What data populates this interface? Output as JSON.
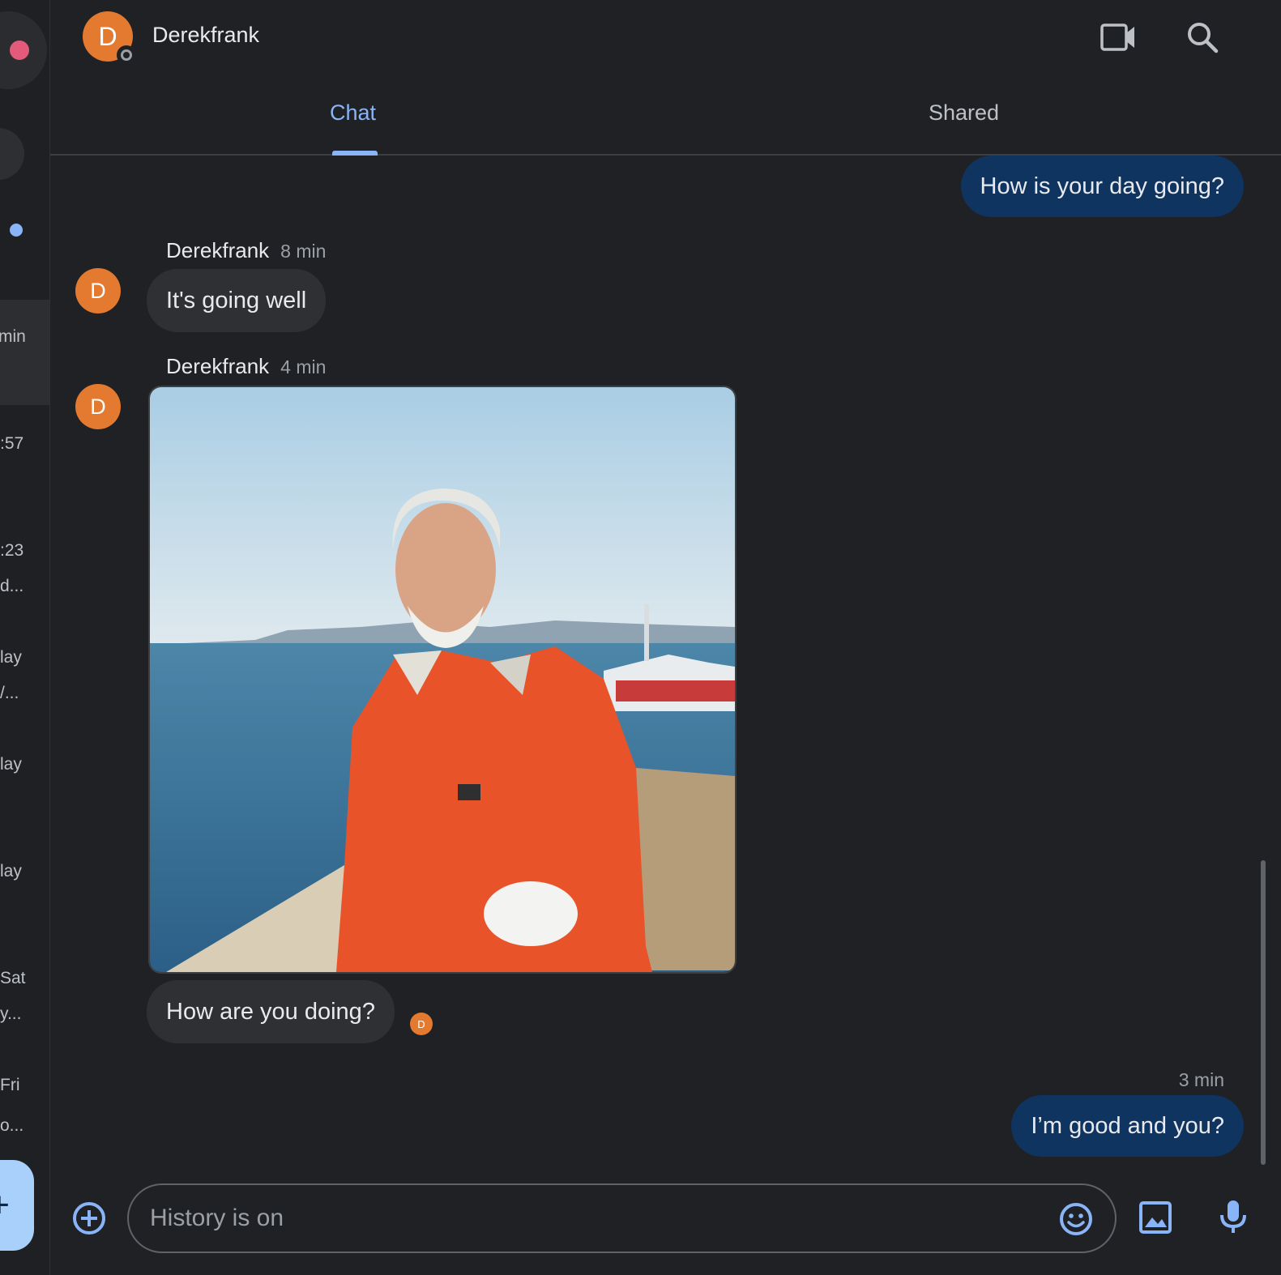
{
  "header": {
    "contact_name": "Derekfrank",
    "avatar_initial": "D",
    "video_call_icon": "video-camera-icon",
    "search_icon": "search-icon"
  },
  "tabs": {
    "chat": "Chat",
    "shared": "Shared",
    "active": "Chat"
  },
  "rail": {
    "items_text": [
      "min",
      ":57",
      ":23",
      "d...",
      "lay",
      "/...",
      "lay",
      "lay",
      "Sat",
      "y...",
      "Fri",
      "o..."
    ],
    "fab_label": "+"
  },
  "messages": [
    {
      "direction": "out",
      "text": "How is your day going?"
    },
    {
      "direction": "in",
      "sender": "Derekfrank",
      "time": "8 min",
      "avatar_initial": "D",
      "text": "It's going well"
    },
    {
      "direction": "in",
      "sender": "Derekfrank",
      "time": "4 min",
      "avatar_initial": "D",
      "image": "photo-man-orange-coverall-sea",
      "text": "How are you doing?",
      "read_receipt_initial": "D"
    },
    {
      "direction": "out",
      "time": "3 min",
      "text": "I’m good and you?"
    }
  ],
  "composer": {
    "placeholder": "History is on",
    "add_icon": "add-circle-icon",
    "emoji_icon": "emoji-icon",
    "image_icon": "image-icon",
    "mic_icon": "microphone-icon"
  },
  "colors": {
    "background": "#202124",
    "outgoing_bubble": "#0f3460",
    "incoming_bubble": "#2f3034",
    "accent": "#8ab4f8",
    "avatar": "#e37a2f"
  }
}
